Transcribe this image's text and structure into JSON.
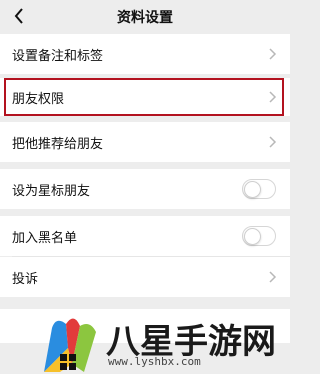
{
  "header": {
    "title": "资料设置"
  },
  "rows": {
    "remark": {
      "label": "设置备注和标签"
    },
    "permissions": {
      "label": "朋友权限"
    },
    "recommend": {
      "label": "把他推荐给朋友"
    },
    "star": {
      "label": "设为星标朋友",
      "toggle_on": false
    },
    "blacklist": {
      "label": "加入黑名单",
      "toggle_on": false
    },
    "report": {
      "label": "投诉"
    }
  },
  "colors": {
    "page_bg": "#ededed",
    "row_bg": "#ffffff",
    "highlight": "#b3121f"
  },
  "icons": [
    "back-arrow-icon",
    "chevron-right-icon",
    "toggle-switch"
  ],
  "watermark": {
    "text": "八星手游网",
    "url": "www.lyshbx.com"
  }
}
